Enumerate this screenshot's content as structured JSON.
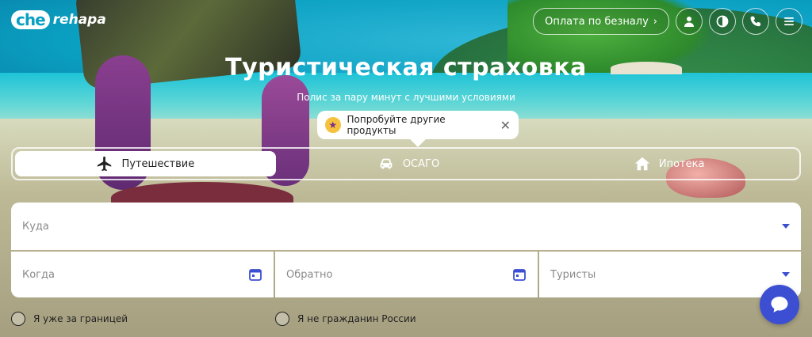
{
  "brand": {
    "logo_mark": "che",
    "logo_text": "rehapa"
  },
  "header": {
    "pay_label": "Оплата по безналу",
    "icons": [
      "user-icon",
      "contrast-icon",
      "phone-icon",
      "menu-icon"
    ]
  },
  "hero": {
    "title": "Туристическая страховка",
    "subtitle": "Полис за пару минут с лучшими условиями"
  },
  "tooltip": {
    "text": "Попробуйте другие продукты",
    "icon": "star-eyes-emoji-icon"
  },
  "tabs": [
    {
      "label": "Путешествие",
      "icon": "airplane-icon",
      "active": true
    },
    {
      "label": "ОСАГО",
      "icon": "car-icon",
      "active": false
    },
    {
      "label": "Ипотека",
      "icon": "house-icon",
      "active": false
    }
  ],
  "form": {
    "where_placeholder": "Куда",
    "when_placeholder": "Когда",
    "back_placeholder": "Обратно",
    "tourists_placeholder": "Туристы"
  },
  "checkboxes": [
    {
      "label": "Я уже за границей",
      "checked": false
    },
    {
      "label": "Я не гражданин России",
      "checked": false
    }
  ],
  "colors": {
    "accent": "#3c4fd2",
    "white": "#ffffff"
  }
}
